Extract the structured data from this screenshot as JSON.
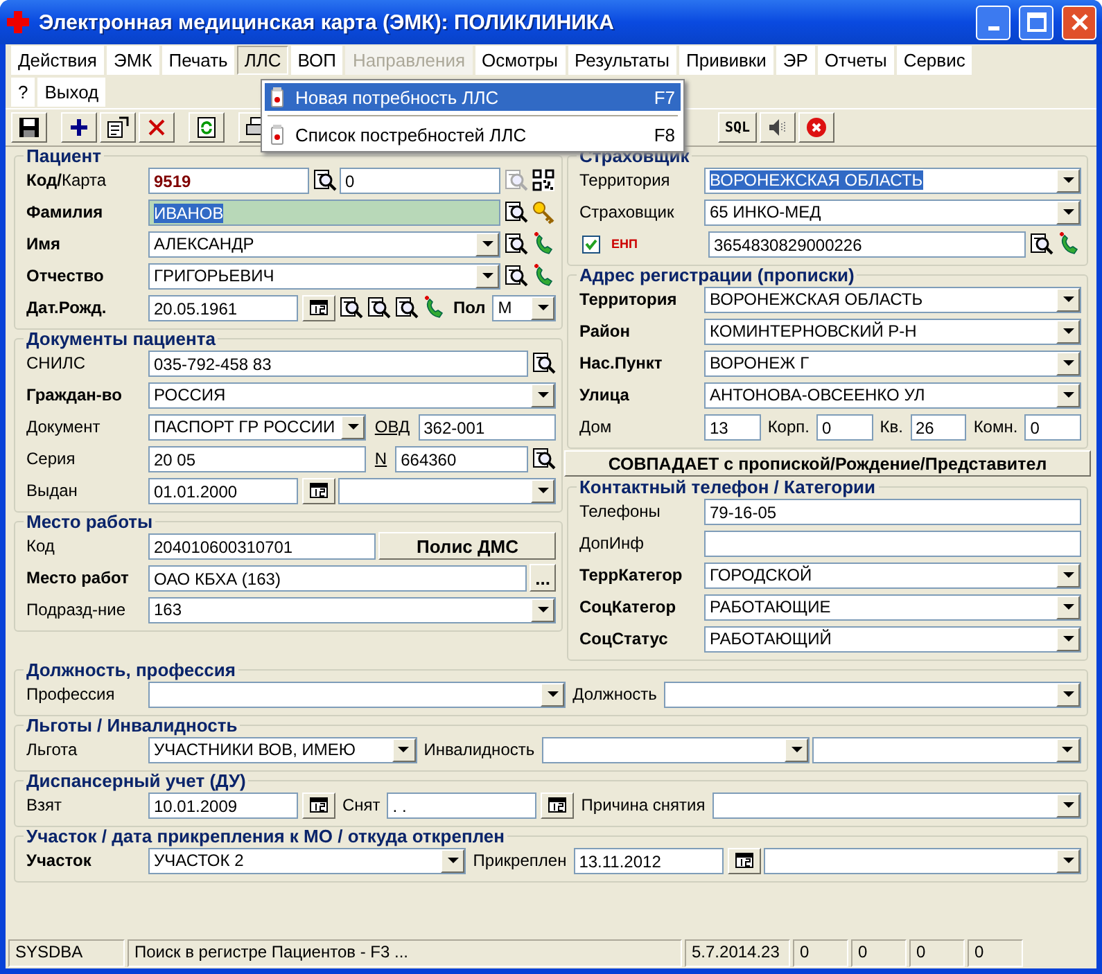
{
  "window": {
    "title": "Электронная медицинская карта (ЭМК): ПОЛИКЛИНИКА"
  },
  "menu": [
    [
      {
        "label": "Действия",
        "selected": false,
        "disabled": false
      },
      {
        "label": "ЭМК",
        "selected": false,
        "disabled": false
      },
      {
        "label": "Печать",
        "selected": false,
        "disabled": false
      },
      {
        "label": "ЛЛС",
        "selected": true,
        "disabled": false
      },
      {
        "label": "ВОП",
        "selected": false,
        "disabled": false
      },
      {
        "label": "Направления",
        "selected": false,
        "disabled": true
      },
      {
        "label": "Осмотры",
        "selected": false,
        "disabled": false
      },
      {
        "label": "Результаты",
        "selected": false,
        "disabled": false
      },
      {
        "label": "Прививки",
        "selected": false,
        "disabled": false
      },
      {
        "label": "ЭР",
        "selected": false,
        "disabled": false
      },
      {
        "label": "Отчеты",
        "selected": false,
        "disabled": false
      },
      {
        "label": "Сервис",
        "selected": false,
        "disabled": false
      }
    ],
    [
      {
        "label": "?",
        "selected": false,
        "disabled": false
      },
      {
        "label": "Выход",
        "selected": false,
        "disabled": false
      }
    ]
  ],
  "open_menu": {
    "items": [
      {
        "label": "Новая потребность ЛЛС",
        "shortcut": "F7",
        "selected": true
      },
      {
        "label": "Список постребностей ЛЛС",
        "shortcut": "F8",
        "selected": false
      }
    ]
  },
  "toolbar": [
    {
      "kind": "save"
    },
    {
      "kind": "new"
    },
    {
      "kind": "properties"
    },
    {
      "kind": "delete"
    },
    {
      "kind": "refresh"
    },
    {
      "kind": "print"
    },
    {
      "kind": "sql",
      "label": "SQL"
    },
    {
      "kind": "sound"
    },
    {
      "kind": "stop"
    }
  ],
  "columns": [
    [
      {
        "kind": "group",
        "title": "Пациент",
        "rows": [
          [
            {
              "kind": "label",
              "text": "**Код/**Карта"
            },
            {
              "kind": "field",
              "value": "9519",
              "bold": true
            },
            {
              "kind": "search"
            },
            {
              "kind": "field",
              "value": "0"
            },
            {
              "kind": "search",
              "disabled": true
            },
            {
              "kind": "qr"
            }
          ],
          [
            {
              "kind": "label",
              "text": "Фамилия",
              "bold": true
            },
            {
              "kind": "field",
              "value": "ИВАНОВ",
              "focused": true,
              "text_selected": true
            },
            {
              "kind": "search"
            },
            {
              "kind": "key"
            }
          ],
          [
            {
              "kind": "label",
              "text": "Имя",
              "bold": true
            },
            {
              "kind": "combo",
              "value": "АЛЕКСАНДР"
            },
            {
              "kind": "search"
            },
            {
              "kind": "phone"
            }
          ],
          [
            {
              "kind": "label",
              "text": "Отчество",
              "bold": true
            },
            {
              "kind": "combo",
              "value": "ГРИГОРЬЕВИЧ"
            },
            {
              "kind": "search"
            },
            {
              "kind": "phone"
            }
          ],
          [
            {
              "kind": "label",
              "text": "Дат.Рожд.",
              "bold": true
            },
            {
              "kind": "date",
              "value": "20.05.1961"
            },
            {
              "kind": "search"
            },
            {
              "kind": "search"
            },
            {
              "kind": "search"
            },
            {
              "kind": "phone"
            },
            {
              "kind": "label",
              "text": "Пол",
              "bold": true
            },
            {
              "kind": "combo",
              "value": "М"
            }
          ]
        ]
      },
      {
        "kind": "group",
        "title": "Документы пациента",
        "rows": [
          [
            {
              "kind": "label",
              "text": "СНИЛС"
            },
            {
              "kind": "field",
              "value": "035-792-458 83"
            },
            {
              "kind": "search"
            }
          ],
          [
            {
              "kind": "label",
              "text": "Граждан-во",
              "bold": true
            },
            {
              "kind": "combo",
              "value": "РОССИЯ"
            }
          ],
          [
            {
              "kind": "label",
              "text": "Документ"
            },
            {
              "kind": "combo",
              "value": "ПАСПОРТ ГР РОССИИ"
            },
            {
              "kind": "link",
              "text": "ОВД"
            },
            {
              "kind": "field",
              "value": "362-001"
            }
          ],
          [
            {
              "kind": "label",
              "text": "Серия"
            },
            {
              "kind": "field",
              "value": "20 05"
            },
            {
              "kind": "link",
              "text": "N"
            },
            {
              "kind": "field",
              "value": "664360"
            },
            {
              "kind": "search"
            }
          ],
          [
            {
              "kind": "label",
              "text": "Выдан"
            },
            {
              "kind": "date",
              "value": "01.01.2000"
            },
            {
              "kind": "combo"
            }
          ]
        ]
      },
      {
        "kind": "group",
        "title": "Место работы",
        "rows": [
          [
            {
              "kind": "label",
              "text": "Код"
            },
            {
              "kind": "field",
              "value": "204010600310701"
            },
            {
              "kind": "button",
              "text": "Полис ДМС"
            }
          ],
          [
            {
              "kind": "label",
              "text": "Место работ",
              "bold": true
            },
            {
              "kind": "field",
              "value": "ОАО КБХА (163)"
            },
            {
              "kind": "button",
              "text": "..."
            }
          ],
          [
            {
              "kind": "label",
              "text": "Подразд-ние"
            },
            {
              "kind": "combo",
              "value": "163"
            }
          ]
        ]
      }
    ],
    [
      {
        "kind": "group",
        "title": "Страховщик",
        "rows": [
          [
            {
              "kind": "label",
              "text": "Территория"
            },
            {
              "kind": "combo",
              "value": "ВОРОНЕЖСКАЯ ОБЛАСТЬ",
              "text_selected": true
            }
          ],
          [
            {
              "kind": "label",
              "text": "Страховщик"
            },
            {
              "kind": "combo",
              "value": "65 ИНКО-МЕД"
            }
          ],
          [
            {
              "kind": "check",
              "text": "ЕНП",
              "checked": true
            },
            {
              "kind": "field",
              "value": "3654830829000226"
            },
            {
              "kind": "search"
            },
            {
              "kind": "phone"
            }
          ]
        ]
      },
      {
        "kind": "group",
        "title": "Адрес регистрации (прописки)",
        "rows": [
          [
            {
              "kind": "label",
              "text": "Территория",
              "bold": true
            },
            {
              "kind": "combo",
              "value": "ВОРОНЕЖСКАЯ ОБЛАСТЬ"
            }
          ],
          [
            {
              "kind": "label",
              "text": "Район",
              "bold": true
            },
            {
              "kind": "combo",
              "value": "КОМИНТЕРНОВСКИЙ Р-Н"
            }
          ],
          [
            {
              "kind": "label",
              "text": "Нас.Пункт",
              "bold": true
            },
            {
              "kind": "combo",
              "value": "ВОРОНЕЖ Г"
            }
          ],
          [
            {
              "kind": "label",
              "text": "Улица",
              "bold": true
            },
            {
              "kind": "combo",
              "value": "АНТОНОВА-ОВСЕЕНКО УЛ"
            }
          ],
          [
            {
              "kind": "label",
              "text": "Дом"
            },
            {
              "kind": "field",
              "value": "13"
            },
            {
              "kind": "label",
              "text": "Корп."
            },
            {
              "kind": "field",
              "value": "0"
            },
            {
              "kind": "label",
              "text": "Кв."
            },
            {
              "kind": "field",
              "value": "26"
            },
            {
              "kind": "label",
              "text": "Комн."
            },
            {
              "kind": "field",
              "value": "0"
            }
          ]
        ]
      },
      {
        "kind": "button",
        "text": "СОВПАДАЕТ с пропиской/Рождение/Представител"
      },
      {
        "kind": "group",
        "title": "Контактный телефон  / Категории",
        "rows": [
          [
            {
              "kind": "label",
              "text": "Телефоны"
            },
            {
              "kind": "field",
              "value": "79-16-05"
            }
          ],
          [
            {
              "kind": "label",
              "text": "ДопИнф"
            },
            {
              "kind": "field"
            }
          ],
          [
            {
              "kind": "label",
              "text": "ТеррКатегор",
              "bold": true
            },
            {
              "kind": "combo",
              "value": "ГОРОДСКОЙ"
            }
          ],
          [
            {
              "kind": "label",
              "text": "СоцКатегор",
              "bold": true
            },
            {
              "kind": "combo",
              "value": "РАБОТАЮЩИЕ"
            }
          ],
          [
            {
              "kind": "label",
              "text": "СоцСтатус",
              "bold": true
            },
            {
              "kind": "combo",
              "value": "РАБОТАЮЩИЙ"
            }
          ]
        ]
      }
    ]
  ],
  "bottom_groups": [
    {
      "kind": "group",
      "title": "Должность, профессия",
      "rows": [
        [
          {
            "kind": "label",
            "text": "Профессия"
          },
          {
            "kind": "combo"
          },
          {
            "kind": "label",
            "text": "Должность"
          },
          {
            "kind": "combo"
          }
        ]
      ]
    },
    {
      "kind": "group",
      "title": "Льготы / Инвалидность",
      "rows": [
        [
          {
            "kind": "label",
            "text": "Льгота"
          },
          {
            "kind": "combo",
            "value": "УЧАСТНИКИ ВОВ, ИМЕЮ"
          },
          {
            "kind": "label",
            "text": "Инвалидность"
          },
          {
            "kind": "combo"
          },
          {
            "kind": "combo"
          }
        ]
      ]
    },
    {
      "kind": "group",
      "title": "Диспансерный учет (ДУ)",
      "rows": [
        [
          {
            "kind": "label",
            "text": "Взят"
          },
          {
            "kind": "date",
            "value": "10.01.2009"
          },
          {
            "kind": "label",
            "text": "Снят"
          },
          {
            "kind": "date",
            "value": " .  ."
          },
          {
            "kind": "label",
            "text": "Причина снятия"
          },
          {
            "kind": "combo"
          }
        ]
      ]
    },
    {
      "kind": "group",
      "title": "Участок / дата прикрепления к МО / откуда откреплен",
      "rows": [
        [
          {
            "kind": "label",
            "text": "Участок",
            "bold": true
          },
          {
            "kind": "combo",
            "value": "УЧАСТОК 2"
          },
          {
            "kind": "label",
            "text": "Прикреплен"
          },
          {
            "kind": "date",
            "value": "13.11.2012"
          },
          {
            "kind": "combo"
          }
        ]
      ]
    }
  ],
  "status_bar": [
    "SYSDBA",
    "Поиск в регистре Пациентов - F3 ...",
    "5.7.2014.23",
    "0",
    "0",
    "0",
    "0"
  ]
}
